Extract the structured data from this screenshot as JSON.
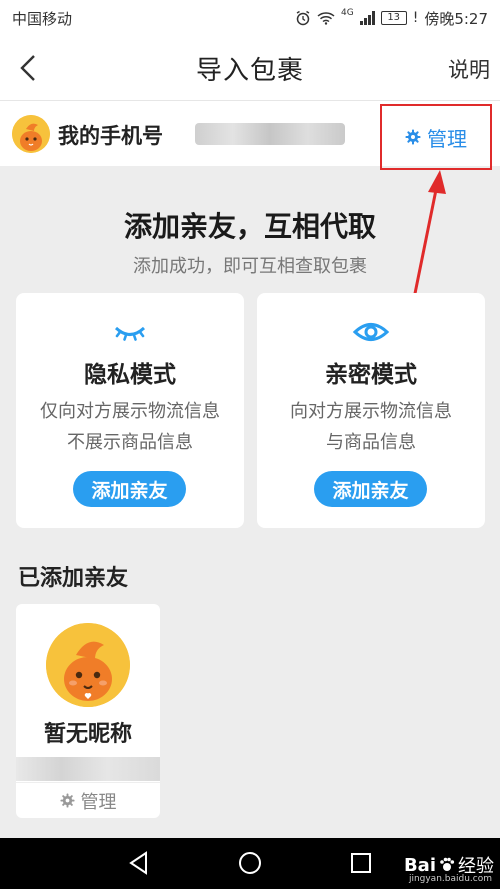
{
  "status": {
    "carrier": "中国移动",
    "network": "4G",
    "battery": "13",
    "time": "傍晚5:27"
  },
  "nav": {
    "title": "导入包裹",
    "help": "说明"
  },
  "phone": {
    "label": "我的手机号",
    "manage": "管理"
  },
  "headline": "添加亲友，互相代取",
  "subline": "添加成功，即可互相查取包裹",
  "cards": [
    {
      "icon": "eye-closed-icon",
      "title": "隐私模式",
      "desc1": "仅向对方展示物流信息",
      "desc2": "不展示商品信息",
      "button": "添加亲友"
    },
    {
      "icon": "eye-open-icon",
      "title": "亲密模式",
      "desc1": "向对方展示物流信息",
      "desc2": "与商品信息",
      "button": "添加亲友"
    }
  ],
  "friends_section": {
    "title": "已添加亲友",
    "items": [
      {
        "name": "暂无昵称",
        "manage": "管理"
      }
    ]
  },
  "watermark": {
    "brand1": "Bai",
    "brand2": "经验",
    "url": "jingyan.baidu.com"
  },
  "colors": {
    "accent": "#2a9ef0",
    "highlight": "#e02b2b",
    "avatar": "#f7c23c"
  }
}
